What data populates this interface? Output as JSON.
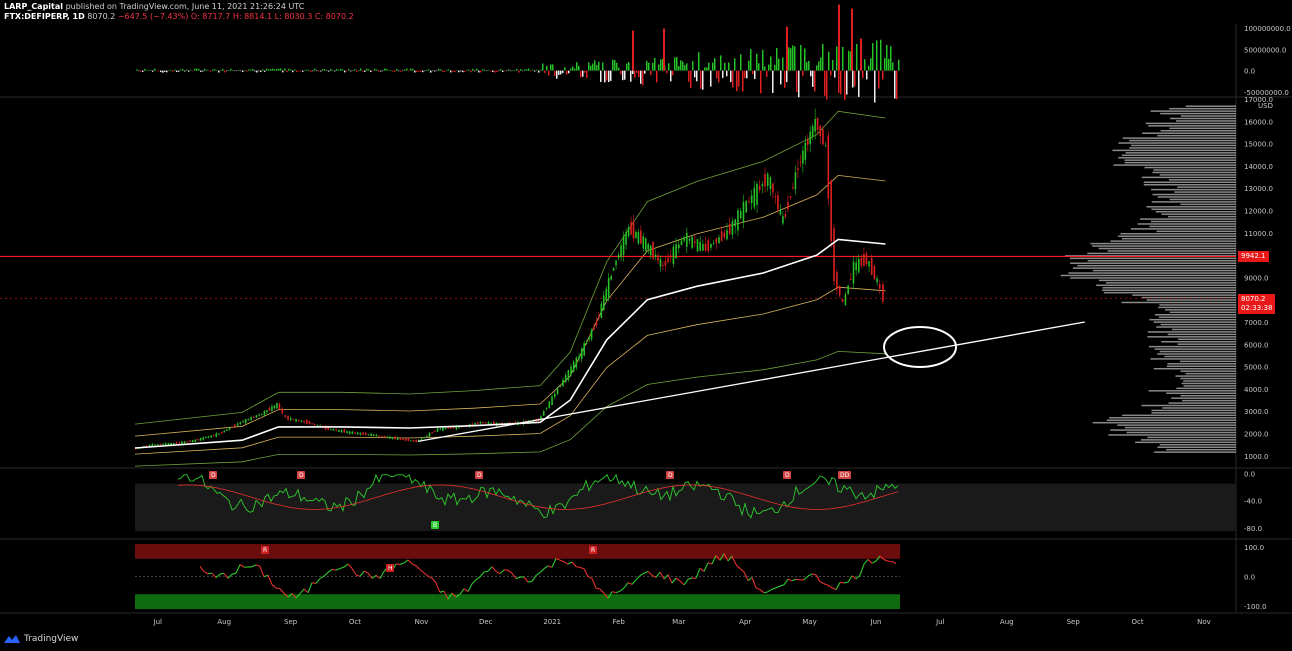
{
  "header": {
    "publisher": "LARP_Capital",
    "published_line": "published on TradingView.com, June 11, 2021 21:26:24 UTC",
    "symbol": "FTX:DEFIPERP, 1D",
    "last": "8070.2",
    "change": "−647.5 (−7.43%)",
    "ohlc": "O: 8717.7  H: 8814.1  L: 8030.3  C: 8070.2"
  },
  "brand": {
    "name": "TradingView",
    "icon": "tradingview-logo-icon"
  },
  "colors": {
    "background": "#000000",
    "up": "#26c126",
    "down": "#e02020",
    "resistance": "#ff1a1a",
    "trendline": "#ffffff",
    "vwap": "#ffffff",
    "band_outer": "#6fa33a",
    "band_inner": "#d8b45a",
    "volume_profile": "#b8b8b8",
    "osc_green": "#2ecc2e",
    "osc_red": "#e8322e",
    "axis_text": "#c8c8c8"
  },
  "price_tags": {
    "resistance": {
      "label": "9942.1",
      "color": "#e81818"
    },
    "current": {
      "label": "8070.2",
      "countdown": "02:33:38",
      "color": "#e81818"
    }
  },
  "chart_data": [
    {
      "type": "bar",
      "name": "volume-delta-pane",
      "y_ticks": [
        "100000000.0",
        "50000000.0",
        "0.0",
        "-50000000.0"
      ],
      "ylim": [
        -60000000,
        110000000
      ]
    },
    {
      "type": "line",
      "name": "price-pane",
      "unit": "USD",
      "y_ticks": [
        "1000.0",
        "2000.0",
        "3000.0",
        "4000.0",
        "5000.0",
        "6000.0",
        "7000.0",
        "8000.0",
        "9000.0",
        "11000.0",
        "12000.0",
        "13000.0",
        "14000.0",
        "15000.0",
        "16000.0",
        "17000.0"
      ],
      "ylim": [
        500,
        17000
      ],
      "x_ticks": [
        "Jul",
        "Aug",
        "Sep",
        "Oct",
        "Nov",
        "Dec",
        "2021",
        "Feb",
        "Mar",
        "Apr",
        "May",
        "Jun",
        "Jul",
        "Aug",
        "Sep",
        "Oct",
        "Nov"
      ],
      "series": [
        {
          "points": [
            [
              "2020-06-26",
              1300
            ],
            [
              "2020-07-05",
              1500
            ],
            [
              "2020-07-15",
              1550
            ],
            [
              "2020-07-25",
              1700
            ],
            [
              "2020-08-05",
              2000
            ],
            [
              "2020-08-15",
              2500
            ],
            [
              "2020-08-25",
              2900
            ],
            [
              "2020-09-01",
              3300
            ],
            [
              "2020-09-05",
              2700
            ],
            [
              "2020-09-15",
              2500
            ],
            [
              "2020-09-25",
              2200
            ],
            [
              "2020-10-05",
              2050
            ],
            [
              "2020-10-15",
              1950
            ],
            [
              "2020-10-25",
              1800
            ],
            [
              "2020-11-05",
              1650
            ],
            [
              "2020-11-15",
              2200
            ],
            [
              "2020-11-25",
              2300
            ],
            [
              "2020-12-05",
              2500
            ],
            [
              "2020-12-15",
              2400
            ],
            [
              "2020-12-25",
              2500
            ],
            [
              "2021-01-01",
              2600
            ],
            [
              "2021-01-10",
              4000
            ],
            [
              "2021-01-20",
              5500
            ],
            [
              "2021-01-28",
              7000
            ],
            [
              "2021-02-05",
              9500
            ],
            [
              "2021-02-12",
              11200
            ],
            [
              "2021-02-20",
              10500
            ],
            [
              "2021-02-28",
              9500
            ],
            [
              "2021-03-10",
              10800
            ],
            [
              "2021-03-20",
              10300
            ],
            [
              "2021-03-30",
              11000
            ],
            [
              "2021-04-08",
              12300
            ],
            [
              "2021-04-18",
              13500
            ],
            [
              "2021-04-25",
              11500
            ],
            [
              "2021-05-02",
              14000
            ],
            [
              "2021-05-10",
              16000
            ],
            [
              "2021-05-15",
              14800
            ],
            [
              "2021-05-19",
              9000
            ],
            [
              "2021-05-23",
              7800
            ],
            [
              "2021-05-28",
              9500
            ],
            [
              "2021-06-03",
              9800
            ],
            [
              "2021-06-08",
              8800
            ],
            [
              "2021-06-11",
              8070
            ]
          ]
        },
        {
          "points": [
            [
              "2020-06-26",
              1350
            ],
            [
              "2020-08-15",
              1700
            ],
            [
              "2020-09-01",
              2300
            ],
            [
              "2020-10-01",
              2300
            ],
            [
              "2020-11-01",
              2250
            ],
            [
              "2020-12-01",
              2350
            ],
            [
              "2021-01-01",
              2500
            ],
            [
              "2021-01-15",
              3500
            ],
            [
              "2021-02-01",
              6200
            ],
            [
              "2021-02-20",
              8000
            ],
            [
              "2021-03-15",
              8600
            ],
            [
              "2021-04-15",
              9200
            ],
            [
              "2021-05-10",
              10000
            ],
            [
              "2021-05-20",
              10700
            ],
            [
              "2021-06-11",
              10500
            ]
          ]
        },
        {
          "points": [
            [
              "2020-11-05",
              1650
            ],
            [
              "2021-09-12",
              7000
            ]
          ]
        }
      ],
      "horizontal_line": 9942.1,
      "last_price": 8070.2
    },
    {
      "type": "line",
      "name": "oscillator-pane-1",
      "y_ticks": [
        "0.0",
        "-40.0",
        "-80.0"
      ],
      "ylim": [
        -95,
        5
      ],
      "signal_labels": [
        "D",
        "D",
        "D",
        "D",
        "D",
        "DD",
        "B"
      ]
    },
    {
      "type": "line",
      "name": "oscillator-pane-2",
      "y_ticks": [
        "100.0",
        "0.0",
        "-100.0"
      ],
      "ylim": [
        -120,
        120
      ],
      "signal_labels": [
        "R",
        "H",
        "R"
      ]
    }
  ]
}
